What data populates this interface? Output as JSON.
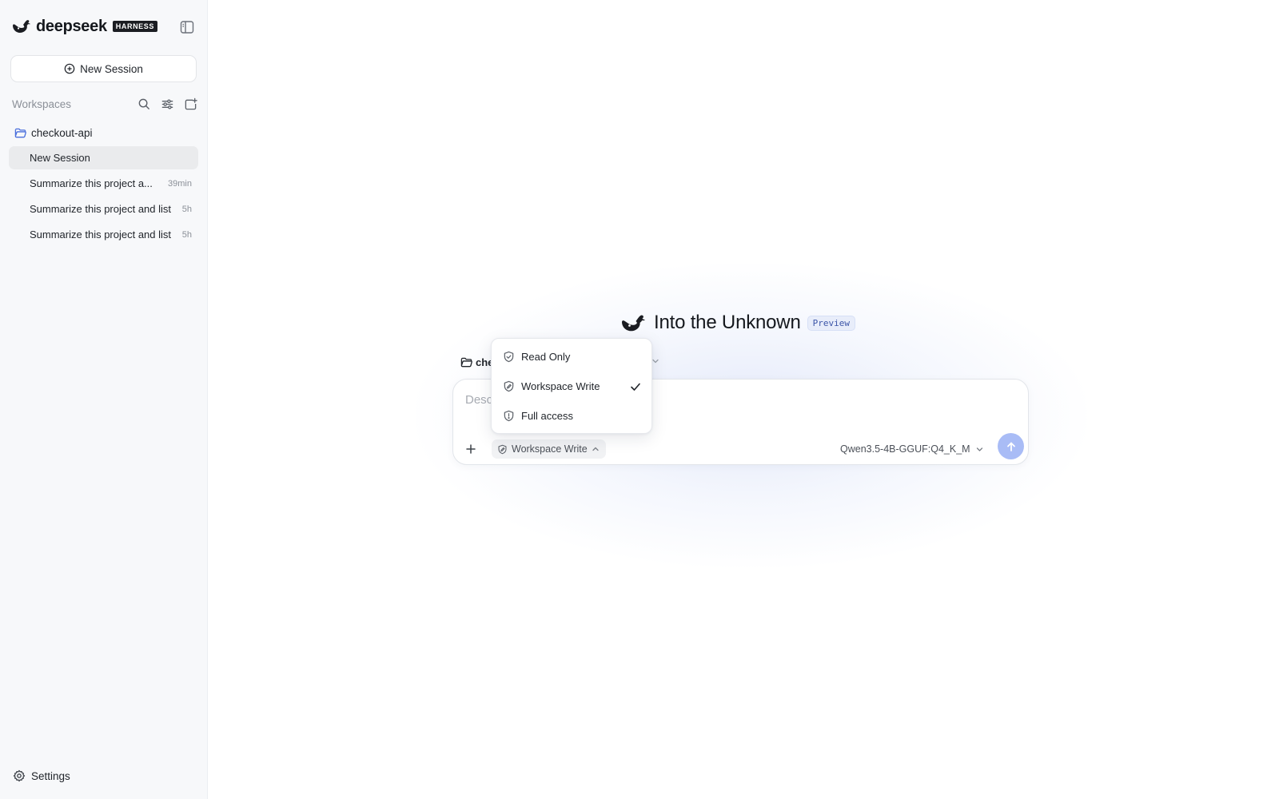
{
  "brand": {
    "name": "deepseek",
    "badge": "HARNESS"
  },
  "sidebar": {
    "new_session_label": "New Session",
    "workspaces_title": "Workspaces",
    "workspace": {
      "name": "checkout-api",
      "sessions": [
        {
          "title": "New Session",
          "time": "",
          "active": true
        },
        {
          "title": "Summarize this project a...",
          "time": "39min",
          "active": false
        },
        {
          "title": "Summarize this project and list",
          "time": "5h",
          "active": false
        },
        {
          "title": "Summarize this project and list",
          "time": "5h",
          "active": false
        }
      ]
    },
    "settings_label": "Settings"
  },
  "main": {
    "hero_title": "Into the Unknown",
    "hero_badge": "Preview",
    "project_chip": "che",
    "composer": {
      "placeholder": "Desc",
      "permission_label": "Workspace Write",
      "model_label": "Qwen3.5-4B-GGUF:Q4_K_M"
    },
    "permission_menu": {
      "items": [
        {
          "label": "Read Only",
          "icon": "shield-check-icon",
          "selected": false
        },
        {
          "label": "Workspace Write",
          "icon": "shield-edit-icon",
          "selected": true
        },
        {
          "label": "Full access",
          "icon": "shield-alert-icon",
          "selected": false
        }
      ]
    }
  },
  "colors": {
    "sidebar_bg": "#f7f8fa",
    "active_item_bg": "#eaebed",
    "send_button": "#a9bcf6",
    "badge_bg": "#e8edfa",
    "badge_text": "#3d56a8",
    "folder_icon": "#4a6fdc"
  }
}
